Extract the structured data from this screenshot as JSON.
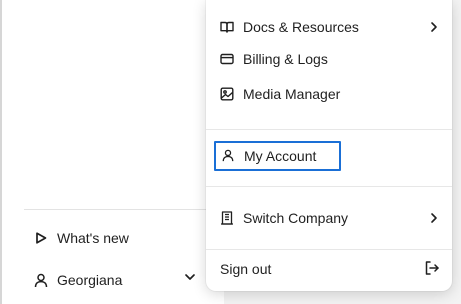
{
  "sidebar": {
    "whats_new_label": "What's new",
    "user_name": "Georgiana"
  },
  "menu": {
    "docs_label": "Docs & Resources",
    "billing_label": "Billing & Logs",
    "media_label": "Media Manager",
    "account_label": "My Account",
    "switch_company_label": "Switch Company",
    "sign_out_label": "Sign out"
  },
  "colors": {
    "focus_outline": "#1a6fd6",
    "text": "#1f1f1f",
    "divider": "#e7e7e7"
  },
  "icons": {
    "docs": "book-icon",
    "billing": "credit-card-icon",
    "media": "image-icon",
    "account": "user-icon",
    "switch_company": "building-icon",
    "sign_out": "sign-out-icon",
    "whats_new": "play-icon",
    "user": "user-icon",
    "submenu": "chevron-right-icon",
    "expand": "chevron-down-icon"
  }
}
